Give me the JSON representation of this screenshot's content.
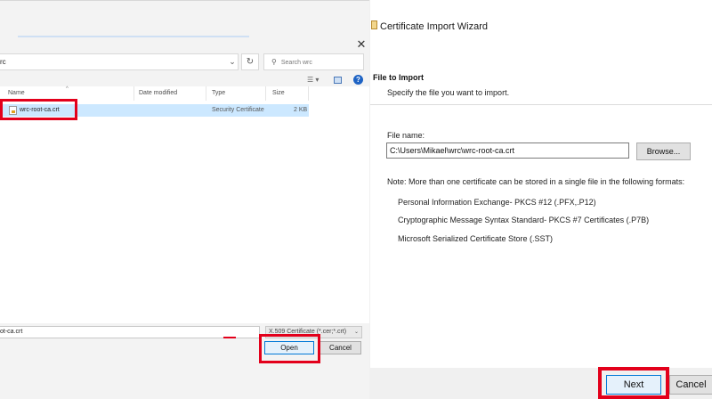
{
  "open_dialog": {
    "close_glyph": "✕",
    "address": "rc",
    "search_placeholder": "Search wrc",
    "columns": [
      "Name",
      "Date modified",
      "Type",
      "Size"
    ],
    "files": [
      {
        "name": "wrc-root-ca.crt",
        "date_modified": "",
        "type": "Security Certificate",
        "size": "2 KB"
      }
    ],
    "file_name_value": "ot-ca.crt",
    "filter_value": "X.509 Certificate (*.cer;*.crt)",
    "open_label": "Open",
    "cancel_label": "Cancel"
  },
  "wizard": {
    "title": "Certificate Import Wizard",
    "heading": "File to Import",
    "subheading": "Specify the file you want to import.",
    "file_name_label": "File name:",
    "file_name_value": "C:\\Users\\Mikael\\wrc\\wrc-root-ca.crt",
    "browse_label": "Browse...",
    "note": "Note:  More than one certificate can be stored in a single file in the following formats:",
    "formats": [
      "Personal Information Exchange- PKCS #12 (.PFX,.P12)",
      "Cryptographic Message Syntax Standard- PKCS #7 Certificates (.P7B)",
      "Microsoft Serialized Certificate Store (.SST)"
    ],
    "next_label": "Next",
    "cancel_label": "Cancel"
  },
  "colors": {
    "highlight": "#e3001b",
    "selection": "#cce8ff",
    "accent": "#0078d7"
  }
}
